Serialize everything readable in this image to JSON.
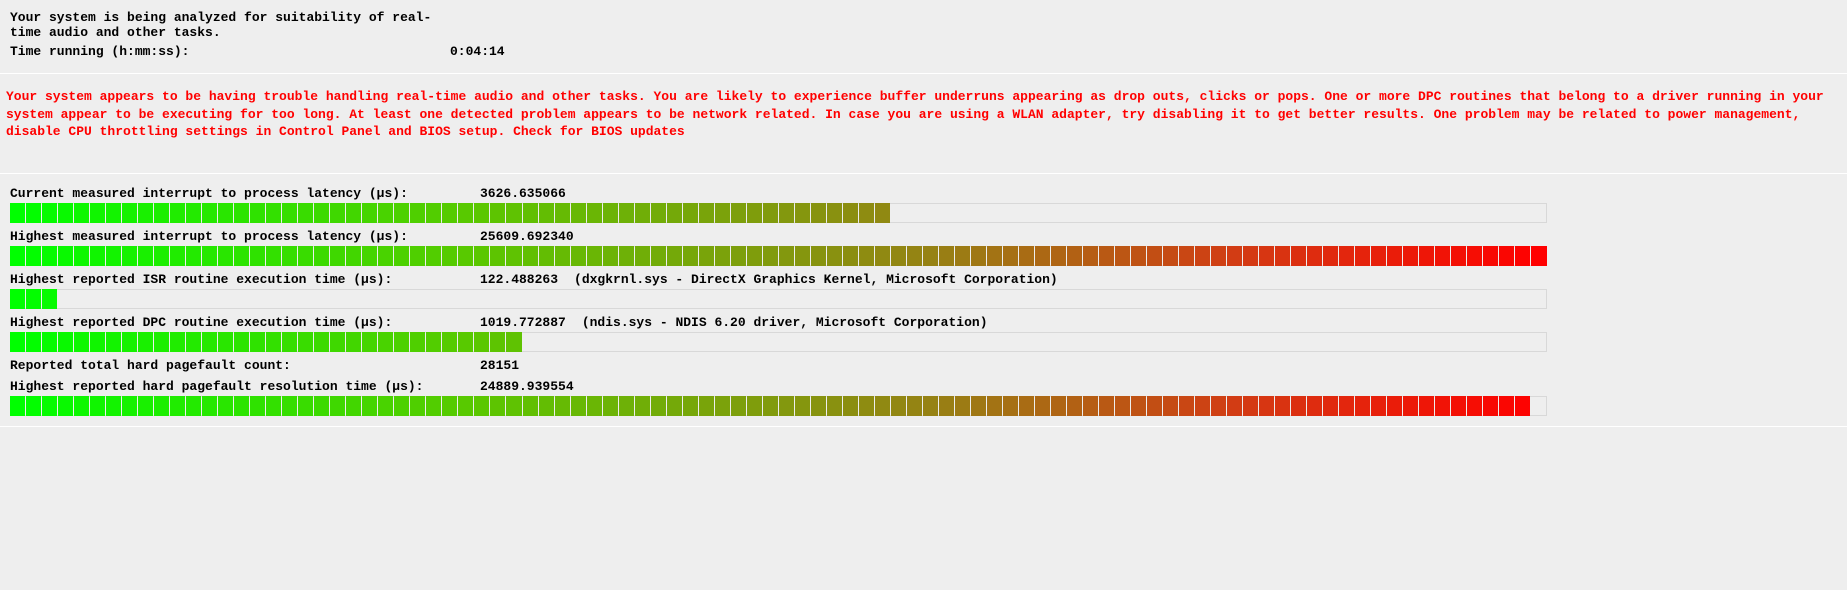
{
  "header": {
    "analyzing_msg": "Your system is being analyzed for suitability of real-time audio and other tasks.",
    "time_running_label": "Time running (h:mm:ss):",
    "time_running_value": "0:04:14"
  },
  "alert": {
    "text": "Your system appears to be having trouble handling real-time audio and other tasks. You are likely to experience buffer underruns appearing as drop outs, clicks or pops. One or more DPC routines that belong to a driver running in your system appear to be executing for too long. At least one detected problem appears to be network related. In case you are using a WLAN adapter, try disabling it to get better results. One problem may be related to power management, disable CPU throttling settings in Control Panel and BIOS setup. Check for BIOS updates"
  },
  "metrics": {
    "current_latency": {
      "label": "Current measured interrupt to process latency (µs):",
      "value": "3626.635066",
      "bar_segments": 55,
      "bar_total": 96
    },
    "highest_latency": {
      "label": "Highest measured interrupt to process latency (µs):",
      "value": "25609.692340",
      "bar_segments": 96,
      "bar_total": 96
    },
    "isr": {
      "label": "Highest reported ISR routine execution time (µs):",
      "value": "122.488263",
      "desc": "(dxgkrnl.sys - DirectX Graphics Kernel, Microsoft Corporation)",
      "bar_segments": 3,
      "bar_total": 96
    },
    "dpc": {
      "label": "Highest reported DPC routine execution time (µs):",
      "value": "1019.772887",
      "desc": "(ndis.sys - NDIS 6.20 driver, Microsoft Corporation)",
      "bar_segments": 32,
      "bar_total": 96
    },
    "pf_count": {
      "label": "Reported total hard pagefault count:",
      "value": "28151"
    },
    "pf_time": {
      "label": "Highest reported hard pagefault resolution time (µs):",
      "value": "24889.939554",
      "bar_segments": 95,
      "bar_total": 96
    }
  }
}
